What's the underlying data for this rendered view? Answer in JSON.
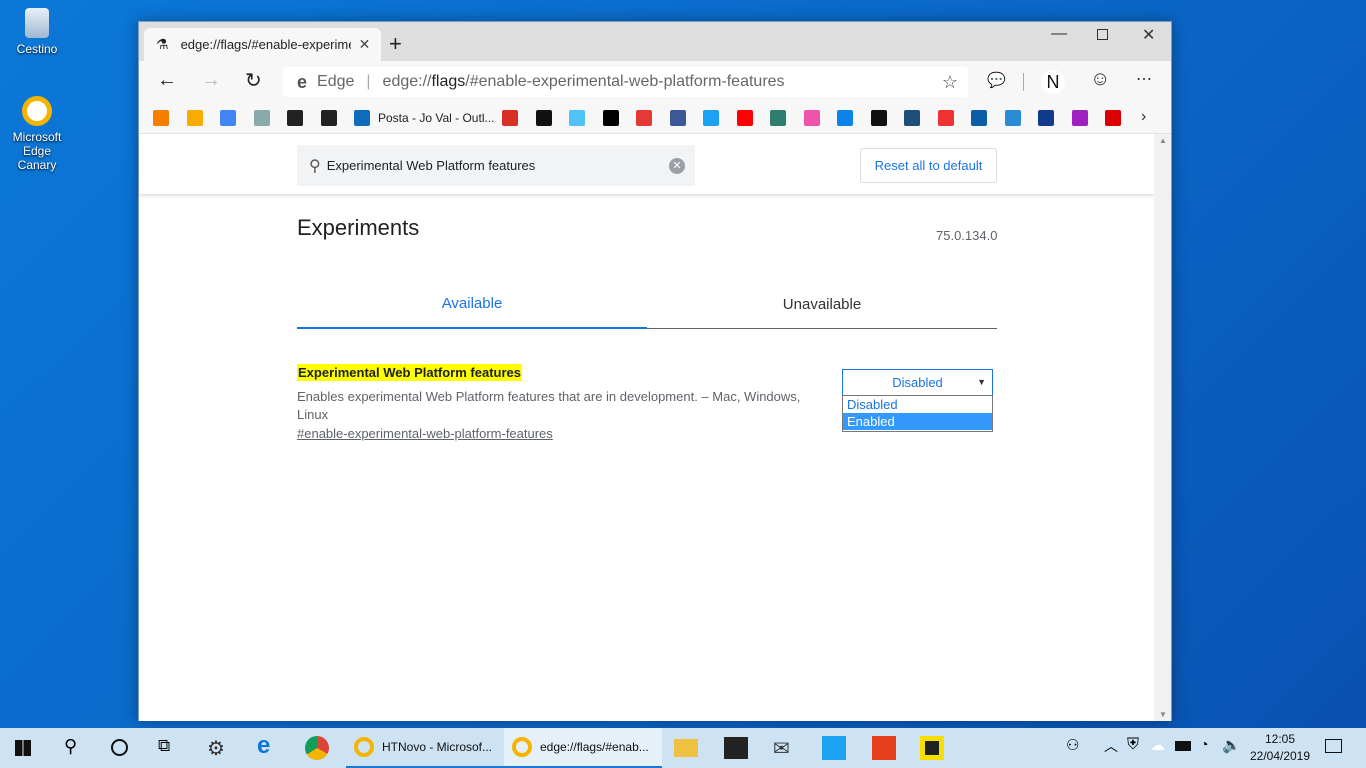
{
  "desktop": {
    "icons": [
      {
        "label": "Cestino"
      },
      {
        "label": "Microsoft Edge Canary"
      }
    ]
  },
  "browser": {
    "tab": {
      "title": "edge://flags/#enable-experiment",
      "icon": "flask-icon"
    },
    "address": {
      "site_label": "Edge",
      "url_prefix": "edge://",
      "url_host": "flags",
      "url_rest": "/#enable-experimental-web-platform-features"
    },
    "profile_initial": "N",
    "bookmarks": [
      {
        "icon": "blogger",
        "color": "#f57d00"
      },
      {
        "icon": "analytics",
        "color": "#f9ab00"
      },
      {
        "icon": "google-ads",
        "color": "#4285f4"
      },
      {
        "icon": "store",
        "color": "#8aa"
      },
      {
        "icon": "amazon",
        "color": "#222"
      },
      {
        "icon": "v",
        "color": "#222"
      },
      {
        "icon": "outlook",
        "color": "#0f6cbd",
        "label": "Posta - Jo Val - Outl..."
      },
      {
        "icon": "gmail",
        "color": "#d93025"
      },
      {
        "icon": "n",
        "color": "#111"
      },
      {
        "icon": "hd",
        "color": "#4fc3f7"
      },
      {
        "icon": "w",
        "color": "#000"
      },
      {
        "icon": "t",
        "color": "#e53935"
      },
      {
        "icon": "facebook",
        "color": "#3b5998"
      },
      {
        "icon": "twitter",
        "color": "#1da1f2"
      },
      {
        "icon": "youtube",
        "color": "#f00"
      },
      {
        "icon": "on",
        "color": "#2e7d6e"
      },
      {
        "icon": "w-logo",
        "color": "#e5a"
      },
      {
        "icon": "windows",
        "color": "#0a84e8"
      },
      {
        "icon": "chevron",
        "color": "#111"
      },
      {
        "icon": "circle-n",
        "color": "#1e4f7a"
      },
      {
        "icon": "t-color",
        "color": "#e33"
      },
      {
        "icon": "o",
        "color": "#0b5da8"
      },
      {
        "icon": "itpro",
        "color": "#2a8bd6"
      },
      {
        "icon": "s",
        "color": "#123a8c"
      },
      {
        "icon": "v-triangle",
        "color": "#a020c0"
      },
      {
        "icon": "ztnet",
        "color": "#d00"
      }
    ]
  },
  "flags": {
    "search_value": "Experimental Web Platform features",
    "reset_label": "Reset all to default",
    "title": "Experiments",
    "version": "75.0.134.0",
    "tabs": [
      {
        "label": "Available",
        "active": true
      },
      {
        "label": "Unavailable",
        "active": false
      }
    ],
    "flag": {
      "name": "Experimental Web Platform features",
      "description": "Enables experimental Web Platform features that are in development. – Mac, Windows, Linux",
      "link": "#enable-experimental-web-platform-features",
      "selected": "Disabled",
      "options": [
        "Disabled",
        "Enabled"
      ],
      "highlighted_option": "Enabled"
    }
  },
  "taskbar": {
    "apps": [
      {
        "label": "HTNovo - Microsof..."
      },
      {
        "label": "edge://flags/#enab..."
      }
    ],
    "time": "12:05",
    "date": "22/04/2019"
  },
  "colors": {
    "accent": "#1a73e8",
    "highlight": "#ffff00",
    "select_blue": "#3399ff"
  }
}
